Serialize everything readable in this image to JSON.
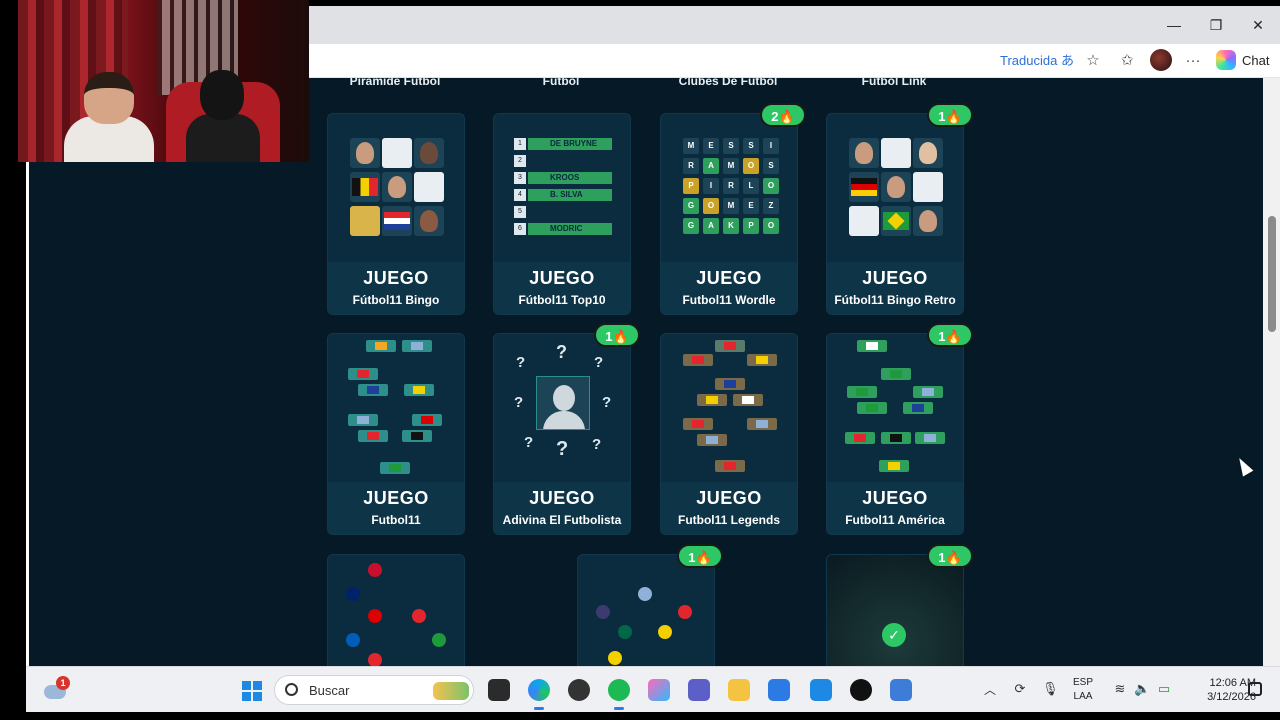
{
  "browser": {
    "translate_label": "Traducida",
    "chat_label": "Chat",
    "window_controls": [
      "minimize",
      "maximize",
      "close"
    ],
    "toolbar_icons": [
      "translate-icon",
      "favorite-star-icon",
      "favorites-icon",
      "profile-avatar",
      "more-menu-icon",
      "copilot-icon"
    ]
  },
  "top_row_titles": [
    "Pirámide Fútbol",
    "Fútbol",
    "Clubes De Fútbol",
    "Fútbol Link"
  ],
  "cards": [
    {
      "juego": "JUEGO",
      "name": "Fútbol11 Bingo",
      "badge": null
    },
    {
      "juego": "JUEGO",
      "name": "Fútbol11 Top10",
      "badge": null
    },
    {
      "juego": "JUEGO",
      "name": "Futbol11 Wordle",
      "badge": "2🔥"
    },
    {
      "juego": "JUEGO",
      "name": "Fútbol11 Bingo Retro",
      "badge": "1🔥"
    },
    {
      "juego": "JUEGO",
      "name": "Futbol11",
      "badge": null
    },
    {
      "juego": "JUEGO",
      "name": "Adivina El Futbolista",
      "badge": "1🔥"
    },
    {
      "juego": "JUEGO",
      "name": "Futbol11 Legends",
      "badge": null
    },
    {
      "juego": "JUEGO",
      "name": "Futbol11 América",
      "badge": "1🔥"
    }
  ],
  "bottom_badges": [
    "1🔥",
    "1🔥"
  ],
  "top10_rows": [
    {
      "n": "1",
      "name": "DE BRUYNE"
    },
    {
      "n": "2",
      "name": ""
    },
    {
      "n": "3",
      "name": "KROOS"
    },
    {
      "n": "4",
      "name": "B. SILVA"
    },
    {
      "n": "5",
      "name": ""
    },
    {
      "n": "6",
      "name": "MODRIC"
    }
  ],
  "wordle_rows": [
    [
      "M",
      "E",
      "S",
      "S",
      "I"
    ],
    [
      "R",
      "A",
      "M",
      "O",
      "S"
    ],
    [
      "P",
      "I",
      "R",
      "L",
      "O"
    ],
    [
      "G",
      "O",
      "M",
      "E",
      "Z"
    ],
    [
      "G",
      "A",
      "K",
      "P",
      "O"
    ]
  ],
  "taskbar": {
    "weather_badge": "1",
    "search_placeholder": "Buscar",
    "lang_top": "ESP",
    "lang_bottom": "LAA",
    "time": "12:06 AM",
    "date": "3/12/2026"
  },
  "colors": {
    "page_bg": "#051a26",
    "card_bg": "#0a2a3c",
    "badge_green": "#2ec765",
    "accent_teal": "#2e8f8a"
  }
}
